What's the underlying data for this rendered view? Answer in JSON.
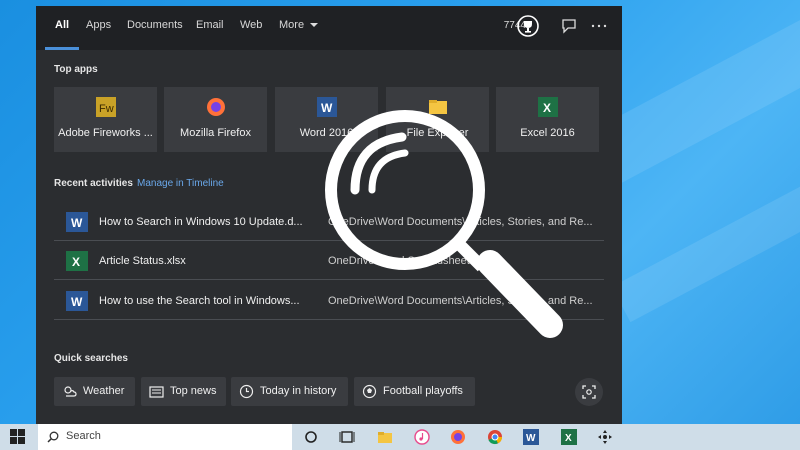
{
  "tabs": [
    {
      "label": "All"
    },
    {
      "label": "Apps"
    },
    {
      "label": "Documents"
    },
    {
      "label": "Email"
    },
    {
      "label": "Web"
    },
    {
      "label": "More"
    }
  ],
  "header": {
    "count": "7744"
  },
  "top_apps": {
    "title": "Top apps",
    "items": [
      {
        "label": "Adobe Fireworks ...",
        "icon": "fireworks-icon"
      },
      {
        "label": "Mozilla Firefox",
        "icon": "firefox-icon"
      },
      {
        "label": "Word 2016",
        "icon": "word-icon"
      },
      {
        "label": "File Explorer",
        "icon": "folder-icon"
      },
      {
        "label": "Excel 2016",
        "icon": "excel-icon"
      }
    ]
  },
  "recent": {
    "title": "Recent activities",
    "link": "Manage in Timeline",
    "items": [
      {
        "name": "How to Search in Windows 10 Update.d...",
        "path": "OneDrive\\Word Documents\\Articles, Stories, and Re...",
        "icon": "word-icon"
      },
      {
        "name": "Article Status.xlsx",
        "path": "OneDrive\\Excel Spreadsheets",
        "icon": "excel-icon"
      },
      {
        "name": "How to use the Search tool in Windows...",
        "path": "OneDrive\\Word Documents\\Articles, Stories, and Re...",
        "icon": "word-icon"
      }
    ]
  },
  "quick_searches": {
    "title": "Quick searches",
    "items": [
      {
        "label": "Weather",
        "icon": "weather-icon"
      },
      {
        "label": "Top news",
        "icon": "news-icon"
      },
      {
        "label": "Today in history",
        "icon": "clock-icon"
      },
      {
        "label": "Football playoffs",
        "icon": "football-icon"
      }
    ]
  },
  "taskbar": {
    "search_placeholder": "Search"
  },
  "colors": {
    "accent": "#4a90d9",
    "panel": "#2b2d30",
    "tile": "#3a3c40",
    "desktop": "#1a8fe0"
  }
}
